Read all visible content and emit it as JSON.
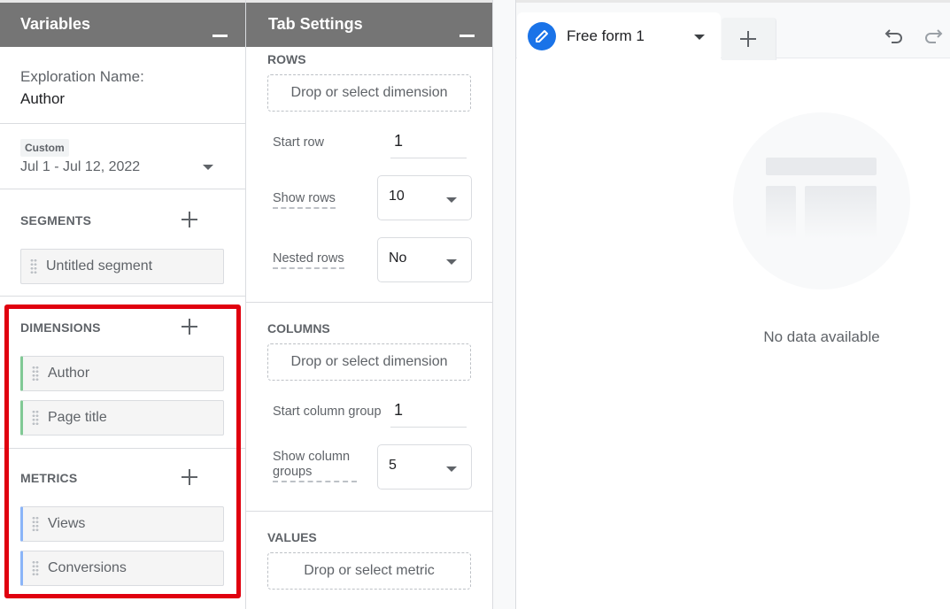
{
  "variables": {
    "title": "Variables",
    "exploration_label": "Exploration Name:",
    "exploration_name": "Author",
    "date_chip": "Custom",
    "date_range": "Jul 1 - Jul 12, 2022",
    "segments": {
      "title": "SEGMENTS",
      "items": [
        "Untitled segment"
      ]
    },
    "dimensions": {
      "title": "DIMENSIONS",
      "items": [
        "Author",
        "Page title"
      ]
    },
    "metrics": {
      "title": "METRICS",
      "items": [
        "Views",
        "Conversions"
      ]
    },
    "highlight_color": "#e0000f",
    "dimension_accent": "#81c995",
    "metric_accent": "#8ab4f8"
  },
  "tab_settings": {
    "title": "Tab Settings",
    "rows": {
      "title": "ROWS",
      "drop_label": "Drop or select dimension",
      "start_row_label": "Start row",
      "start_row_value": "1",
      "show_rows_label": "Show rows",
      "show_rows_value": "10",
      "nested_rows_label": "Nested rows",
      "nested_rows_value": "No"
    },
    "columns": {
      "title": "COLUMNS",
      "drop_label": "Drop or select dimension",
      "start_group_label": "Start column group",
      "start_group_value": "1",
      "show_groups_label": "Show column groups",
      "show_groups_value": "5"
    },
    "values": {
      "title": "VALUES",
      "drop_label": "Drop or select metric"
    }
  },
  "canvas": {
    "tab_label": "Free form 1",
    "tab_icon": "pencil-icon",
    "accent": "#1a73e8",
    "empty_message": "No data available"
  }
}
